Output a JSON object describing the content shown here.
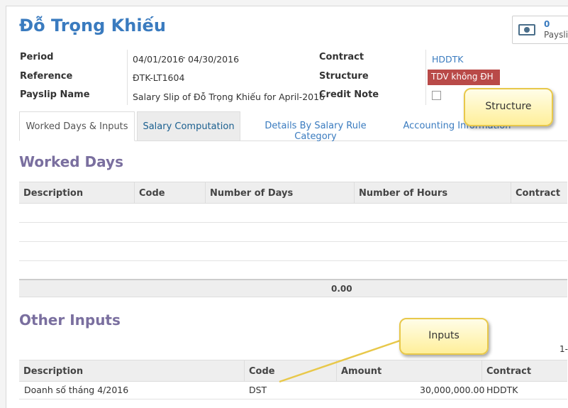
{
  "employee_name": "Đỗ Trọng Khiếu",
  "payslips_button": {
    "count": "0",
    "label": "Payslip",
    "icon": "money-icon"
  },
  "fields": {
    "period": {
      "label": "Period",
      "date_from": "04/01/2016",
      "separator": "-",
      "date_to": "04/30/2016"
    },
    "reference": {
      "label": "Reference",
      "value": "ĐTK-LT1604"
    },
    "payslip_name": {
      "label": "Payslip Name",
      "value": "Salary Slip of Đỗ Trọng Khiếu for April-2016"
    },
    "contract": {
      "label": "Contract",
      "value": "HDDTK"
    },
    "structure": {
      "label": "Structure",
      "value": "TDV không ĐH",
      "badge_color": "#b94a48"
    },
    "credit_note": {
      "label": "Credit Note",
      "checked": false
    }
  },
  "callouts": {
    "structure": "Structure",
    "inputs": "Inputs"
  },
  "tabs": [
    {
      "label": "Worked Days & Inputs",
      "active": true
    },
    {
      "label": "Salary Computation",
      "active": false
    },
    {
      "label": "Details By Salary Rule Category",
      "active": false
    },
    {
      "label": "Accounting Information",
      "active": false
    }
  ],
  "worked_days": {
    "title": "Worked Days",
    "columns": [
      "Description",
      "Code",
      "Number of Days",
      "Number of Hours",
      "Contract"
    ],
    "rows": [],
    "total_days": "0.00"
  },
  "other_inputs": {
    "title": "Other Inputs",
    "pager": "1-",
    "columns": [
      "Description",
      "Code",
      "Amount",
      "Contract"
    ],
    "rows": [
      {
        "description": "Doanh số tháng 4/2016",
        "code": "DST",
        "amount": "30,000,000.00",
        "contract": "HDDTK"
      }
    ]
  },
  "colors": {
    "title": "#3a7bbf",
    "section": "#7a6f9f",
    "link": "#3a7bbf",
    "callout_border": "#e8c84a"
  }
}
